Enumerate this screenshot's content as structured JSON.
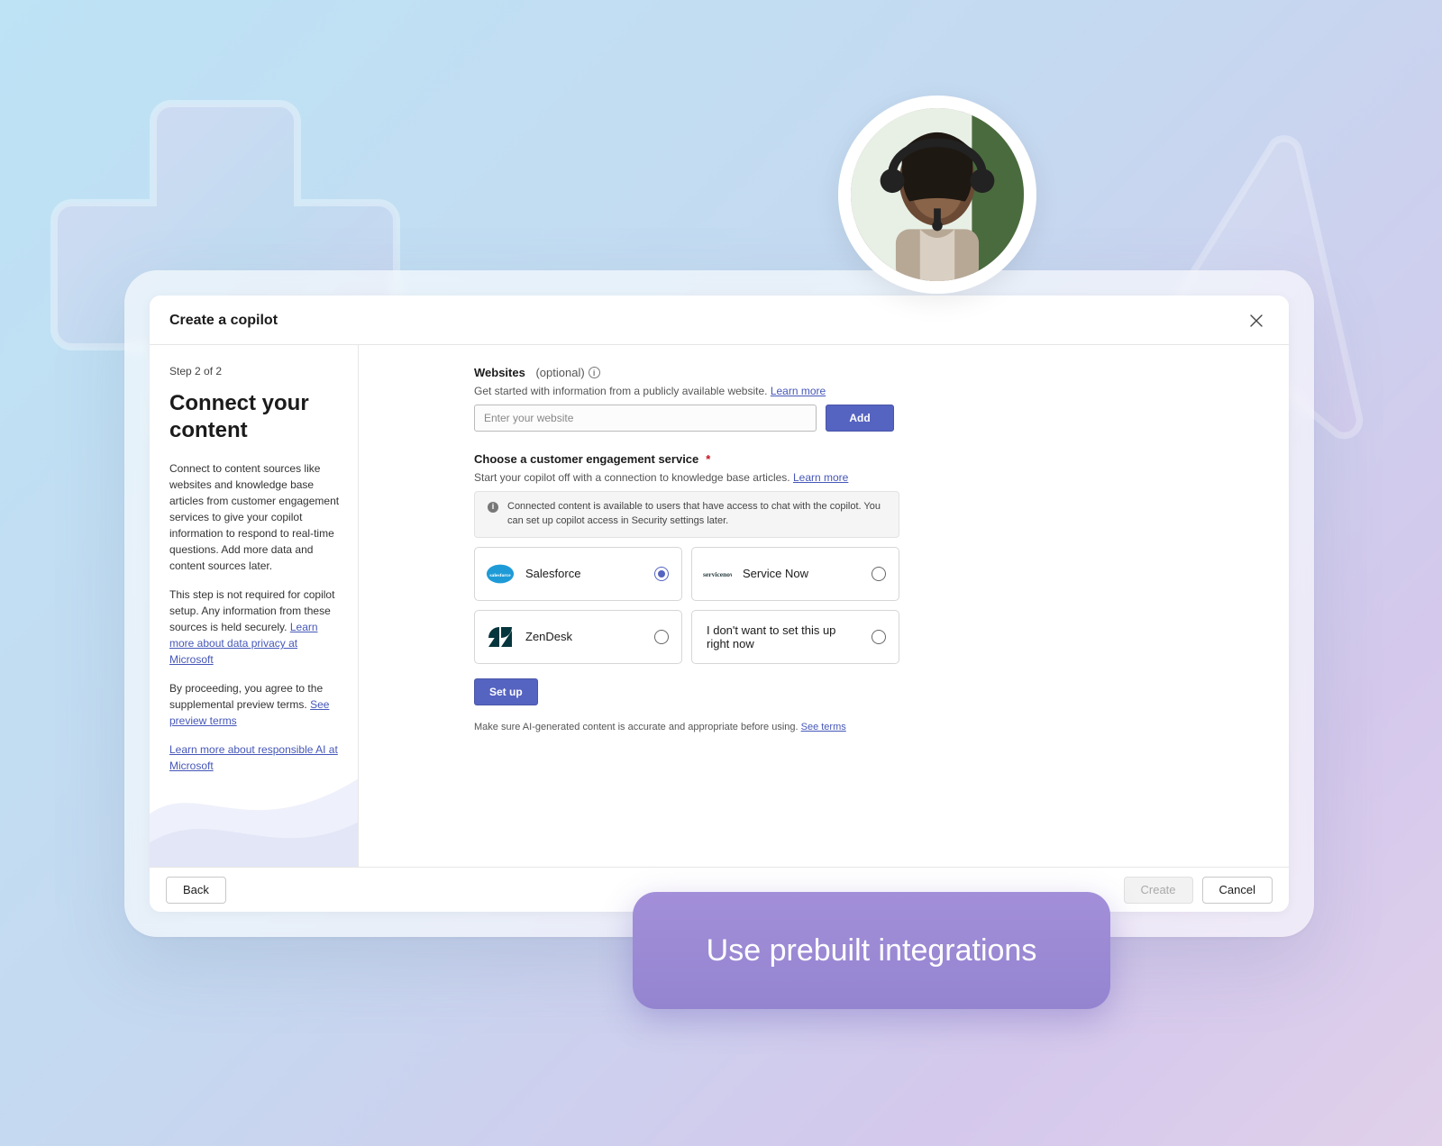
{
  "dialog": {
    "title": "Create a copilot",
    "step_label": "Step 2 of 2",
    "heading": "Connect your content",
    "para1": "Connect to content sources like websites and knowledge base articles from customer engagement services to give your copilot information to respond to real-time questions. Add more data and content sources later.",
    "para2_a": "This step is not required for copilot setup. Any information from these sources is held securely. ",
    "para2_link": "Learn more about data privacy at Microsoft",
    "para3_a": "By proceeding, you agree to the supplemental preview terms. ",
    "para3_link": "See preview terms",
    "para4_link": "Learn more about responsible AI at Microsoft"
  },
  "websites": {
    "label": "Websites",
    "optional": "(optional)",
    "helper_a": "Get started with information from a publicly available website. ",
    "helper_link": "Learn more",
    "placeholder": "Enter your website",
    "add": "Add"
  },
  "engagement": {
    "label": "Choose a customer engagement service",
    "helper_a": "Start your copilot off with a connection to knowledge base articles. ",
    "helper_link": "Learn more",
    "banner": "Connected content is available to users that have access to chat with the copilot. You can set up copilot access in Security settings later.",
    "services": [
      {
        "name": "Salesforce",
        "selected": true,
        "icon": "salesforce"
      },
      {
        "name": "Service Now",
        "selected": false,
        "icon": "servicenow"
      },
      {
        "name": "ZenDesk",
        "selected": false,
        "icon": "zendesk"
      },
      {
        "name": "I don't want to set this up right now",
        "selected": false,
        "icon": null
      }
    ],
    "setup": "Set up"
  },
  "disclaimer_a": "Make sure AI-generated content is accurate and appropriate before using. ",
  "disclaimer_link": "See terms",
  "footer": {
    "back": "Back",
    "create": "Create",
    "cancel": "Cancel"
  },
  "overlay": "Use prebuilt integrations"
}
